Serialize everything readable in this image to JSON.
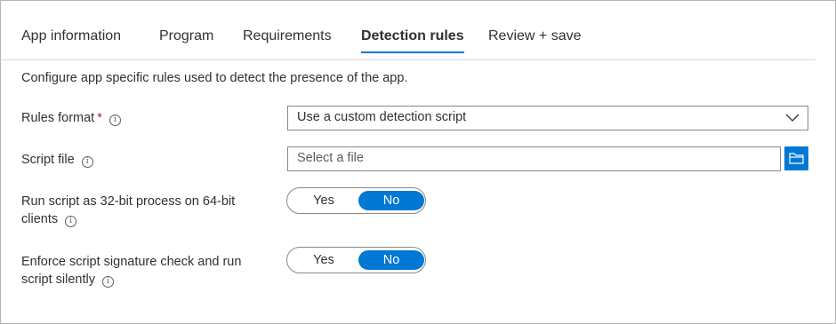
{
  "tabs": [
    {
      "label": "App information"
    },
    {
      "label": "Program"
    },
    {
      "label": "Requirements"
    },
    {
      "label": "Detection rules"
    },
    {
      "label": "Review + save"
    }
  ],
  "active_tab": "Detection rules",
  "intro": "Configure app specific rules used to detect the presence of the app.",
  "fields": {
    "rules_format": {
      "label": "Rules format",
      "required_mark": "*",
      "value": "Use a custom detection script"
    },
    "script_file": {
      "label": "Script file",
      "placeholder": "Select a file"
    },
    "run_32bit": {
      "label": "Run script as 32-bit process on 64-bit clients",
      "options": [
        "Yes",
        "No"
      ],
      "selected": "No"
    },
    "enforce_signature": {
      "label": "Enforce script signature check and run script silently",
      "options": [
        "Yes",
        "No"
      ],
      "selected": "No"
    }
  },
  "icons": {
    "info": "info-icon",
    "dropdown": "chevron-down-icon",
    "browse": "folder-icon"
  },
  "colors": {
    "accent": "#0078d4",
    "required": "#a4262c",
    "text": "#323130"
  }
}
